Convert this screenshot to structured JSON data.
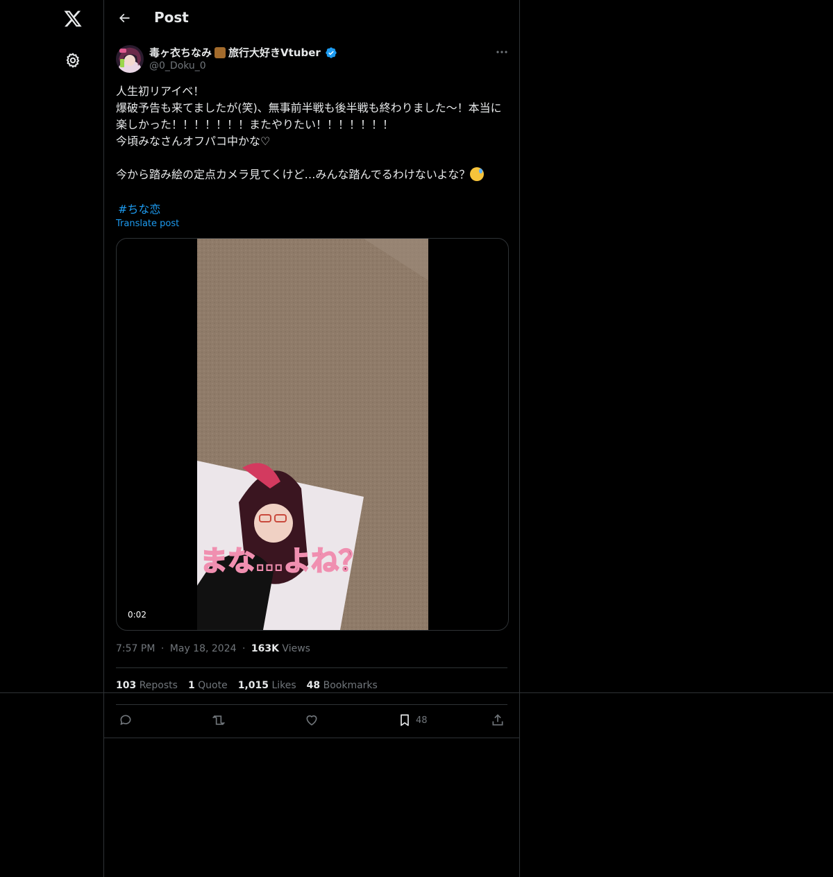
{
  "app": {
    "logo_icon": "x-logo-icon",
    "settings_icon": "gear-icon"
  },
  "header": {
    "title": "Post",
    "back_icon": "arrow-left-icon"
  },
  "author": {
    "display_name_part1": "毒ヶ衣ちなみ",
    "display_name_part2": "旅行大好きVtuber",
    "handle": "@0_Doku_0",
    "verified": true
  },
  "post": {
    "text": "人生初リアイベ！\n爆破予告も来てましたが(笑)、無事前半戦も後半戦も終わりました〜！本当に楽しかった！！！！！！！またやりたい！！！！！！！\n今頃みなさんオフパコ中かな♡\n\n今から踏み絵の定点カメラ見てくけど…みんな踏んでるわけないよな？",
    "hashtag": "#ちな恋",
    "translate_label": "Translate post",
    "video_time": "0:02",
    "video_caption": "まな…よね？",
    "time": "7:57 PM",
    "date": "May 18, 2024",
    "views_count": "163K",
    "views_label": "Views",
    "separator": "·"
  },
  "stats": {
    "reposts_count": "103",
    "reposts_label": "Reposts",
    "quotes_count": "1",
    "quotes_label": "Quote",
    "likes_count": "1,015",
    "likes_label": "Likes",
    "bookmarks_count": "48",
    "bookmarks_label": "Bookmarks"
  },
  "actions": {
    "reply_icon": "reply-icon",
    "repost_icon": "repost-icon",
    "like_icon": "heart-icon",
    "bookmark_icon": "bookmark-icon",
    "bookmark_count": "48",
    "share_icon": "share-icon"
  },
  "colors": {
    "accent": "#1d9bf0",
    "text": "#e7e9ea",
    "muted": "#71767b",
    "border": "#2f3336",
    "background": "#000000"
  }
}
